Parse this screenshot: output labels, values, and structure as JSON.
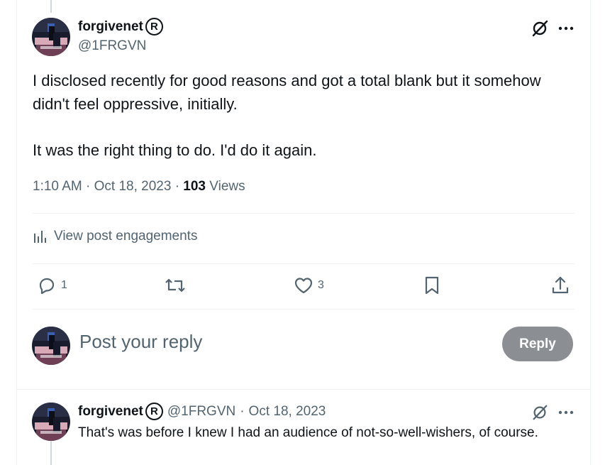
{
  "main_post": {
    "author_name": "forgivenet",
    "author_badge": "R",
    "author_handle": "@1FRGVN",
    "text_line1": "I disclosed recently for good reasons and got a total blank but it somehow didn't feel oppressive, initially.",
    "text_line2": "It was the right thing to do. I'd do it again.",
    "time": "1:10 AM",
    "date": "Oct 18, 2023",
    "views_count": "103",
    "views_label": "Views",
    "engagements_label": "View post engagements"
  },
  "actions": {
    "reply_count": "1",
    "like_count": "3"
  },
  "composer": {
    "placeholder": "Post your reply",
    "reply_button": "Reply"
  },
  "reply_post": {
    "author_name": "forgivenet",
    "author_badge": "R",
    "author_handle": "@1FRGVN",
    "separator": "·",
    "date": "Oct 18, 2023",
    "text": "That's was before I knew I had an audience of not-so-well-wishers, of course."
  },
  "colors": {
    "text_primary": "#0f1419",
    "text_secondary": "#536471",
    "divider": "#eff3f4",
    "reply_button_disabled": "#8b8f93"
  },
  "icons": {
    "grok": "slashed-circle-icon",
    "more": "more-dots-icon",
    "analytics": "bar-chart-icon",
    "reply": "speech-bubble-icon",
    "repost": "repost-arrows-icon",
    "like": "heart-icon",
    "bookmark": "bookmark-icon",
    "share": "share-upload-icon"
  }
}
